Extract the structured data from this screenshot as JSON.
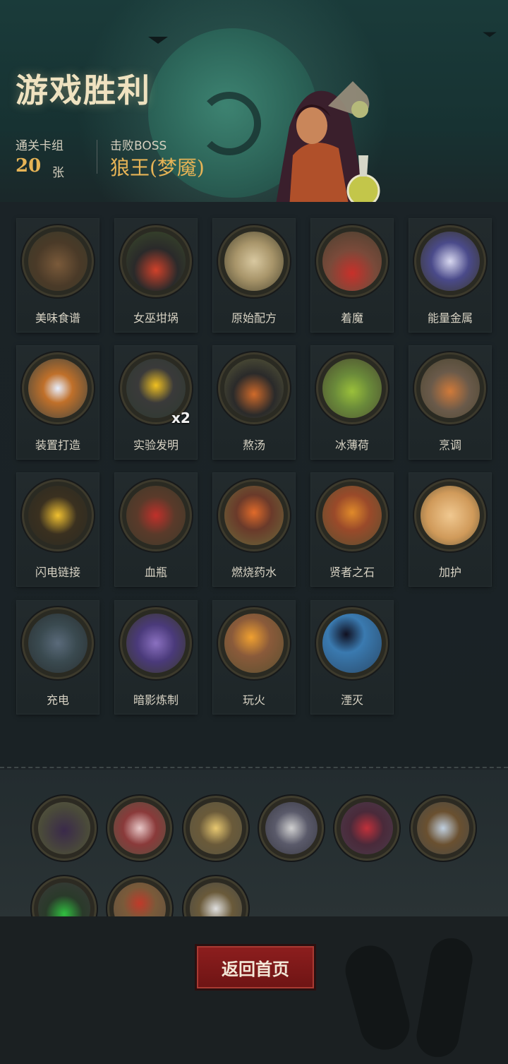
{
  "header": {
    "title": "游戏胜利",
    "cleared_decks_label": "通关卡组",
    "cleared_decks_value": "20",
    "cleared_decks_unit": "张",
    "boss_label": "击败BOSS",
    "boss_name": "狼王(梦魇)"
  },
  "cards": [
    {
      "label": "美味食谱",
      "icon": "recipe-book-icon"
    },
    {
      "label": "女巫坩埚",
      "icon": "witch-cauldron-icon"
    },
    {
      "label": "原始配方",
      "icon": "scroll-icon"
    },
    {
      "label": "着魔",
      "icon": "possessed-man-icon"
    },
    {
      "label": "能量金属",
      "icon": "energy-metal-icon"
    },
    {
      "label": "装置打造",
      "icon": "device-forge-icon"
    },
    {
      "label": "实验发明",
      "icon": "robot-invention-icon",
      "count": "x2"
    },
    {
      "label": "熬汤",
      "icon": "soup-pot-icon"
    },
    {
      "label": "冰薄荷",
      "icon": "mint-drink-icon"
    },
    {
      "label": "烹调",
      "icon": "fox-cook-icon"
    },
    {
      "label": "闪电链接",
      "icon": "lightning-icon"
    },
    {
      "label": "血瓶",
      "icon": "blood-bottle-icon"
    },
    {
      "label": "燃烧药水",
      "icon": "fire-potion-icon"
    },
    {
      "label": "贤者之石",
      "icon": "philosopher-stone-icon"
    },
    {
      "label": "加护",
      "icon": "shield-blessing-icon"
    },
    {
      "label": "充电",
      "icon": "charge-icon"
    },
    {
      "label": "暗影炼制",
      "icon": "shadow-alchemy-icon"
    },
    {
      "label": "玩火",
      "icon": "fire-play-icon"
    },
    {
      "label": "湮灭",
      "icon": "annihilation-icon"
    }
  ],
  "relics": [
    {
      "icon": "dark-cloak-icon"
    },
    {
      "icon": "twins-icon"
    },
    {
      "icon": "hourglass-icon"
    },
    {
      "icon": "pirate-sword-icon"
    },
    {
      "icon": "vampire-icon"
    },
    {
      "icon": "rabbit-coins-icon"
    },
    {
      "icon": "green-wizard-icon"
    },
    {
      "icon": "red-beads-icon"
    },
    {
      "icon": "sword-hand-icon"
    }
  ],
  "footer": {
    "home_button_label": "返回首页"
  },
  "colors": {
    "accent_gold": "#e7b456",
    "button_red": "#8d1e1e"
  }
}
